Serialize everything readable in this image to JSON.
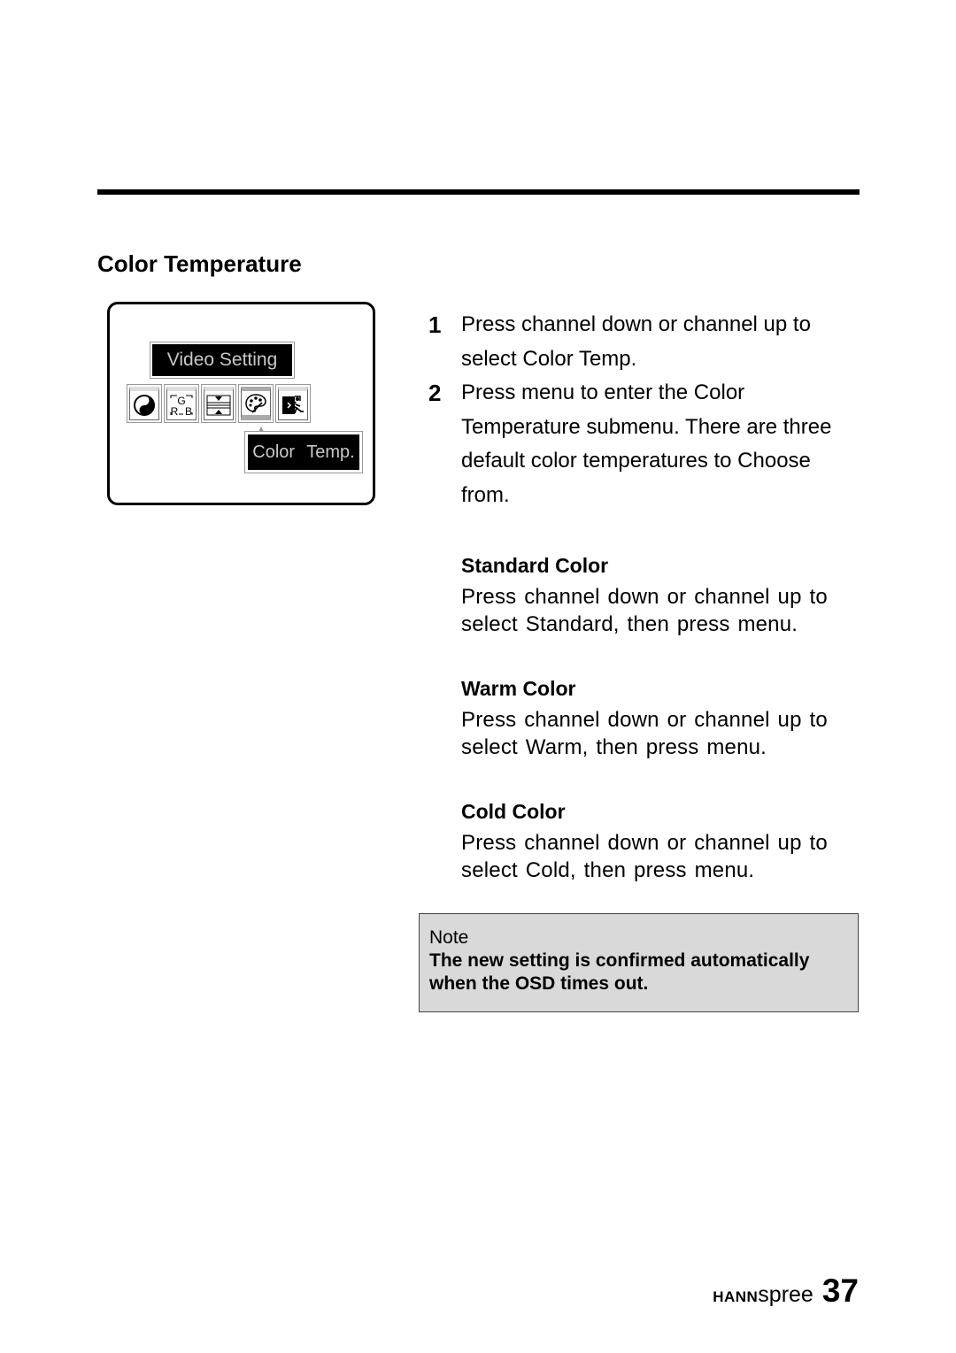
{
  "section": {
    "title": "Color Temperature"
  },
  "osd": {
    "header": "Video Setting",
    "icons": [
      {
        "name": "contrast-icon"
      },
      {
        "name": "rgb-icon",
        "top": "G",
        "left": "R",
        "right": "B"
      },
      {
        "name": "picture-position-icon"
      },
      {
        "name": "color-palette-icon",
        "selected": true
      },
      {
        "name": "exit-icon"
      }
    ],
    "selected_label": "Color Temp."
  },
  "steps": [
    {
      "number": "1",
      "text": "Press channel down or channel up to select Color Temp."
    },
    {
      "number": "2",
      "text": "Press menu to enter the Color Temperature submenu. There are three default color temperatures to Choose from."
    }
  ],
  "options": [
    {
      "title": "Standard Color",
      "description": "Press channel down or channel up to select Standard, then press menu."
    },
    {
      "title": "Warm Color",
      "description": "Press channel down or channel up to select Warm, then press menu."
    },
    {
      "title": "Cold Color",
      "description": "Press channel down or channel up to select Cold, then press menu."
    }
  ],
  "note": {
    "title": "Note",
    "body": "The new setting is confirmed automatically when the OSD times out."
  },
  "footer": {
    "brand_bold": "HANN",
    "brand_light": "spree",
    "page_number": "37"
  }
}
